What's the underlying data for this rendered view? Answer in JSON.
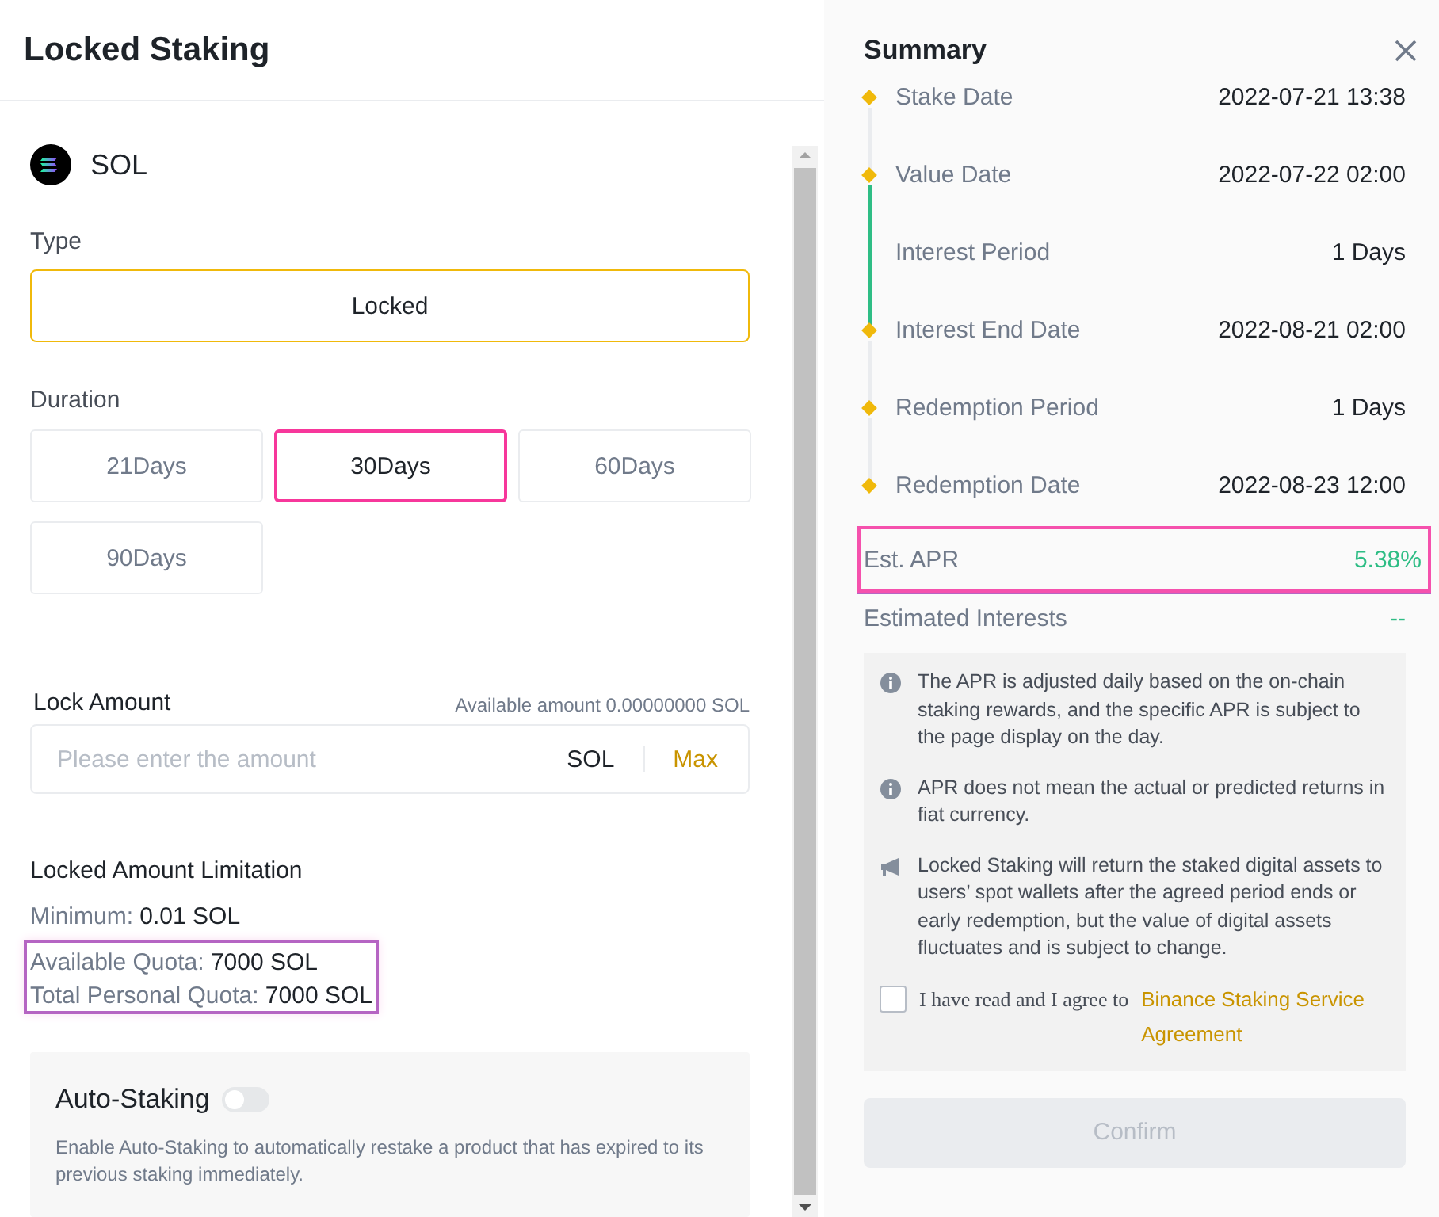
{
  "title": "Locked Staking",
  "asset": {
    "symbol": "SOL"
  },
  "type": {
    "label": "Type",
    "options": [
      {
        "label": "Locked",
        "selected": true
      }
    ]
  },
  "duration": {
    "label": "Duration",
    "options": [
      {
        "label": "21Days",
        "selected": false,
        "highlighted": false
      },
      {
        "label": "30Days",
        "selected": true,
        "highlighted": true
      },
      {
        "label": "60Days",
        "selected": false,
        "highlighted": false
      },
      {
        "label": "90Days",
        "selected": false,
        "highlighted": false
      }
    ]
  },
  "lock_amount": {
    "label": "Lock Amount",
    "available": "Available amount 0.00000000 SOL",
    "placeholder": "Please enter the amount",
    "unit": "SOL",
    "max_button": "Max"
  },
  "limitation": {
    "title": "Locked Amount Limitation",
    "lines": [
      {
        "text": "Minimum: **0.01 SOL**",
        "highlighted": false
      },
      {
        "text": "Available Quota: **7000 SOL**",
        "highlighted": true
      },
      {
        "text": "Total Personal Quota: **7000 SOL**",
        "highlighted": true
      }
    ]
  },
  "auto_staking": {
    "label": "Auto-Staking",
    "on": false,
    "description": "Enable Auto-Staking to automatically restake a product that has expired to its previous staking immediately."
  },
  "summary": {
    "title": "Summary",
    "rows": [
      {
        "kind": "milestone",
        "label": "Stake Date",
        "value": "2022-07-21 13:38"
      },
      {
        "kind": "milestone",
        "label": "Value Date",
        "value": "2022-07-22 02:00"
      },
      {
        "kind": "period",
        "label": "Interest Period",
        "value": "1 Days"
      },
      {
        "kind": "milestone",
        "label": "Interest End Date",
        "value": "2022-08-21 02:00"
      },
      {
        "kind": "milestone",
        "label": "Redemption Period",
        "value": "1 Days"
      },
      {
        "kind": "milestone",
        "label": "Redemption Date",
        "value": "2022-08-23 12:00"
      }
    ]
  },
  "apr": {
    "label": "Est. APR",
    "value": "5.38%",
    "highlighted": true
  },
  "estimated_interests": {
    "label": "Estimated Interests",
    "value": "--"
  },
  "notes": [
    {
      "kind": "info",
      "text": "The APR is adjusted daily based on the on-chain staking rewards, and the specific APR is subject to the page display on the day."
    },
    {
      "kind": "info",
      "text": "APR does not mean the actual or predicted returns in fiat currency."
    },
    {
      "kind": "announcement",
      "text": "Locked Staking will return the staked digital assets to users’ spot wallets after the agreed period ends or early redemption, but the value of digital assets fluctuates and is subject to change."
    }
  ],
  "agreement": {
    "checked": false,
    "text": "I have read and I agree to",
    "link": "Binance Staking Service Agreement"
  },
  "confirm": {
    "label": "Confirm",
    "disabled": true
  }
}
